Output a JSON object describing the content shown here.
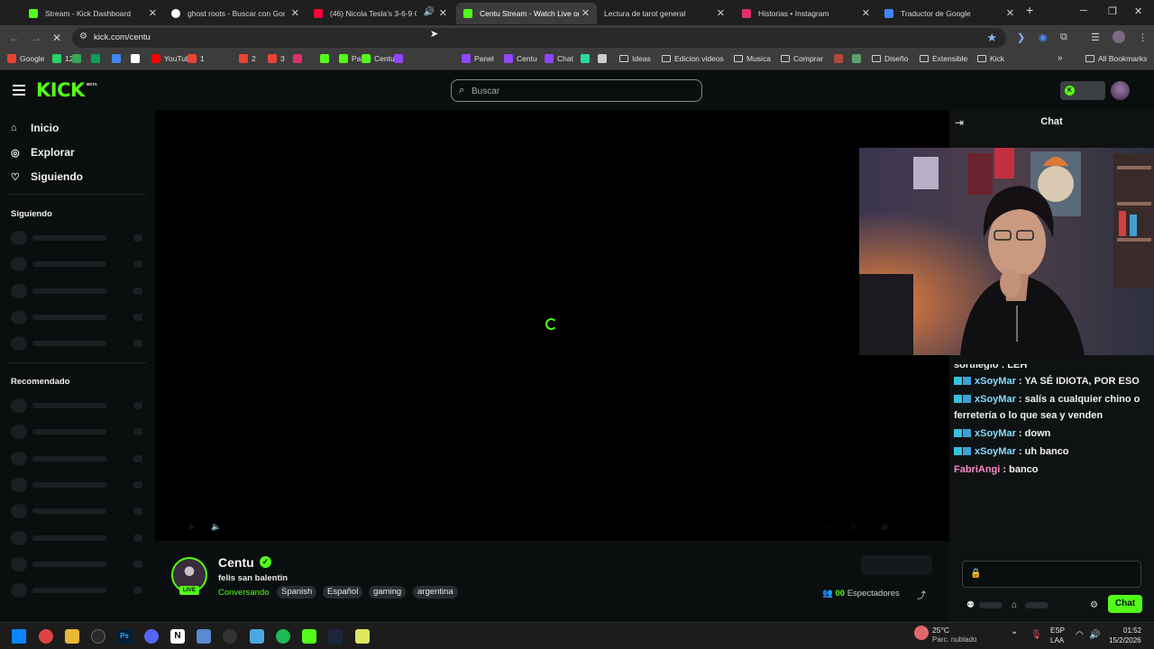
{
  "browser": {
    "tabs": [
      {
        "title": "Stream - Kick Dashboard",
        "color": "#53fc18"
      },
      {
        "title": "ghost roots - Buscar con Google",
        "color": "#ffffff"
      },
      {
        "title": "(46) Nicola Tesla's 3-6-9 Co",
        "color": "#ff0033"
      },
      {
        "title": "Centu Stream - Watch Live on K",
        "color": "#53fc18"
      },
      {
        "title": "Lectura de tarot general",
        "color": "#ffffff"
      },
      {
        "title": "Historias • Instagram",
        "color": "#e1306c"
      },
      {
        "title": "Traductor de Google",
        "color": "#4285f4"
      }
    ],
    "url": "kick.com/centu",
    "new_tab": "+",
    "bookmarks": [
      {
        "label": "Google",
        "color": "#ea4335"
      },
      {
        "label": "12",
        "color": "#25d366"
      },
      {
        "label": "",
        "color": "#34a853"
      },
      {
        "label": "",
        "color": "#0f9d58"
      },
      {
        "label": "",
        "color": "#4285f4"
      },
      {
        "label": "",
        "color": "#ffffff"
      },
      {
        "label": "YouTube",
        "color": "#ff0000"
      },
      {
        "label": "1",
        "color": "#ea4335"
      },
      {
        "label": "2",
        "color": "#ea4335"
      },
      {
        "label": "3",
        "color": "#ea4335"
      },
      {
        "label": "",
        "color": "#e1306c"
      },
      {
        "label": "",
        "color": "#53fc18"
      },
      {
        "label": "Panel",
        "color": "#53fc18"
      },
      {
        "label": "Centu",
        "color": "#53fc18"
      },
      {
        "label": "",
        "color": "#9146ff"
      },
      {
        "label": "Panel",
        "color": "#9146ff"
      },
      {
        "label": "Centu",
        "color": "#9146ff"
      },
      {
        "label": "Chat",
        "color": "#9146ff"
      },
      {
        "label": "",
        "color": "#2bd9a0"
      },
      {
        "label": "",
        "color": "#cccccc"
      },
      {
        "label": "Ideas",
        "color": "folder"
      },
      {
        "label": "Edicion videos",
        "color": "folder"
      },
      {
        "label": "Musica",
        "color": "folder"
      },
      {
        "label": "Comprar",
        "color": "folder"
      },
      {
        "label": "",
        "color": "#b14a3a"
      },
      {
        "label": "",
        "color": "#5aa06a"
      },
      {
        "label": "Diseño",
        "color": "folder"
      },
      {
        "label": "Extensible",
        "color": "folder"
      },
      {
        "label": "Kick",
        "color": "folder"
      }
    ],
    "more_bookmarks": "»",
    "all_bookmarks": "All Bookmarks"
  },
  "kick": {
    "logo": "KICK",
    "logo_badge": "BETA",
    "search_placeholder": "Buscar",
    "nav": {
      "home": "Inicio",
      "explore": "Explorar",
      "following": "Siguiendo"
    },
    "sidebar": {
      "following_title": "Siguiendo",
      "recommended_title": "Recomendado"
    },
    "chat": {
      "title": "Chat",
      "messages": [
        {
          "user": "sortilegio",
          "text": "LEH",
          "badge": false,
          "partial": true
        },
        {
          "user": "xSoyMar",
          "text": "YA SÉ IDIOTA, POR ESO",
          "badge": true
        },
        {
          "user": "xSoyMar",
          "text": "salís a cualquier chino o ferretería o lo que sea y venden",
          "badge": true
        },
        {
          "user": "xSoyMar",
          "text": "down",
          "badge": true
        },
        {
          "user": "xSoyMar",
          "text": "uh banco",
          "badge": true
        },
        {
          "user": "FabriAngi",
          "text": "banco",
          "badge": false,
          "color": "pink"
        }
      ],
      "send_label": "Chat"
    },
    "channel": {
      "name": "Centu",
      "live": "LIVE",
      "stream_title": "felis san balentin",
      "category": "Conversando",
      "tags": [
        "Spanish",
        "Español",
        "gaming",
        "argentina"
      ],
      "viewers": "00",
      "viewers_label": "Espectadores"
    },
    "colors": {
      "brand": "#53fc18",
      "bg": "#0b0e0f"
    }
  },
  "taskbar": {
    "weather_temp": "25°C",
    "weather_desc": "Parc. nublado",
    "lang_top": "ESP",
    "lang_bottom": "LAA",
    "time": "01:52",
    "date": "15/2/2026"
  }
}
